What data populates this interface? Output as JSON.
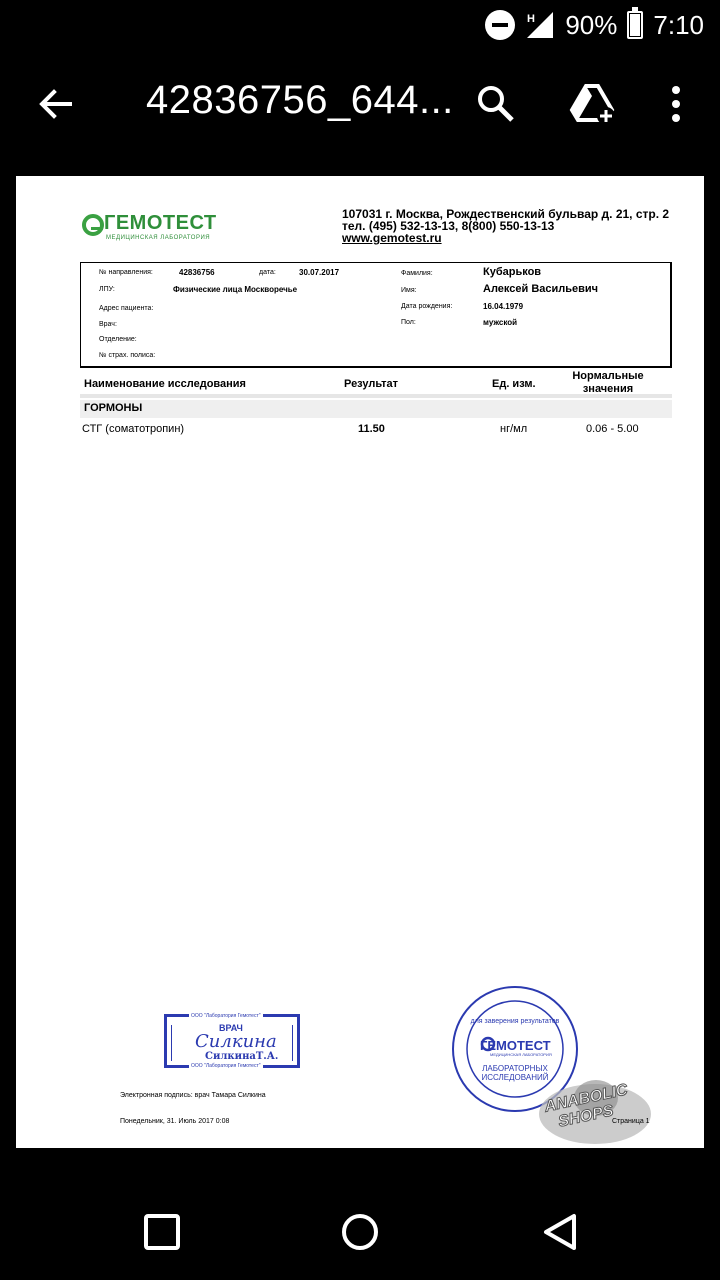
{
  "status": {
    "battery": "90%",
    "time": "7:10",
    "network": "H",
    "battery_level": 0.9
  },
  "appbar": {
    "title": "42836756_644..."
  },
  "doc": {
    "logo": {
      "name": "ГЕМОТЕСТ",
      "sub": "МЕДИЦИНСКАЯ ЛАБОРАТОРИЯ"
    },
    "address": {
      "line1": "107031 г. Москва, Рождественский бульвар д. 21, стр. 2",
      "line2": "тел. (495) 532-13-13, 8(800) 550-13-13",
      "url": "www.gemotest.ru"
    },
    "info": {
      "referral_label": "№ направления:",
      "referral": "42836756",
      "date_label": "дата:",
      "date": "30.07.2017",
      "lpu_label": "ЛПУ:",
      "lpu": "Физические лица Москворечье",
      "patient_address_label": "Адрес пациента:",
      "doctor_label": "Врач:",
      "department_label": "Отделение:",
      "insurance_label": "№ страх. полиса:",
      "surname_label": "Фамилия:",
      "surname": "Кубарьков",
      "name_label": "Имя:",
      "name": "Алексей Васильевич",
      "birth_label": "Дата рождения:",
      "birth": "16.04.1979",
      "sex_label": "Пол:",
      "sex": "мужской"
    },
    "table": {
      "headers": {
        "test": "Наименование исследования",
        "result": "Результат",
        "unit": "Ед. изм.",
        "norm": "Нормальные значения"
      },
      "section": "ГОРМОНЫ",
      "rows": [
        {
          "test": "СТГ (соматотропин)",
          "result": "11.50",
          "unit": "нг/мл",
          "norm": "0.06 - 5.00"
        }
      ]
    },
    "stamp_rect": {
      "top": "ООО \"Лаборатория Гемотест\"",
      "title": "ВРАЧ",
      "signature": "Силкина",
      "name": "СилкинаТ.А.",
      "bottom": "ООО \"Лаборатория Гемотест\""
    },
    "stamp_round": {
      "top": "для заверения результатов",
      "brand": "ГЕМОТЕСТ",
      "brand_sub": "МЕДИЦИНСКАЯ ЛАБОРАТОРИЯ",
      "bottom": "ЛАБОРАТОРНЫХ ИССЛЕДОВАНИЙ"
    },
    "watermark": {
      "line1": "ANABOLIC",
      "line2": "SHOPS"
    },
    "footer": {
      "esign": "Электронная подпись: врач Тамара Силкина",
      "datetime": "Понедельник, 31. Июль 2017 0:08",
      "page": "Страница 1"
    }
  },
  "icons": {
    "back": "arrow-back-icon",
    "search": "search-icon",
    "drive": "drive-add-icon",
    "more": "more-vert-icon",
    "recents": "square-icon",
    "home": "circle-icon",
    "nav_back": "triangle-back-icon"
  }
}
